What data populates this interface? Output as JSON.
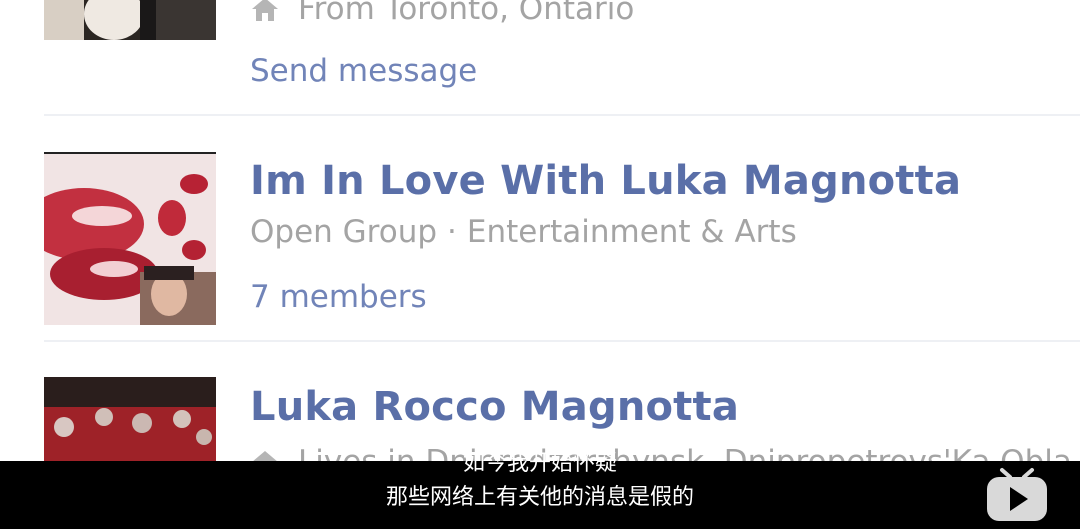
{
  "results": [
    {
      "location": "From Toronto, Ontario",
      "action_label": "Send message"
    },
    {
      "name": "Im In Love With Luka Magnotta",
      "type": "Open Group",
      "category": "Entertainment & Arts",
      "separator": "·",
      "members": "7 members"
    },
    {
      "name": "Luka Rocco Magnotta",
      "location": "Lives in Dniprodzerzhynsk, Dnipropetrovs'Ka Obla..."
    }
  ],
  "subtitles": {
    "line1": "如今我开始怀疑",
    "line2": "那些网络上有关他的消息是假的"
  },
  "watermark": {
    "icon": "play-tv-logo-icon"
  },
  "colors": {
    "name_link": "#5a6fa8",
    "action_link": "#7184b8",
    "meta_text": "#a4a4a4",
    "subtitle_bg": "#000000"
  }
}
